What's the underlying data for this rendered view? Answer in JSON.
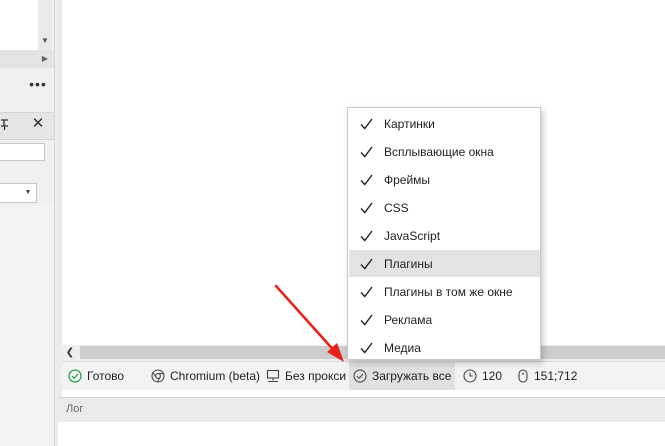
{
  "menu": {
    "items": [
      {
        "label": "Картинки",
        "checked": true
      },
      {
        "label": "Всплывающие окна",
        "checked": true
      },
      {
        "label": "Фреймы",
        "checked": true
      },
      {
        "label": "CSS",
        "checked": true
      },
      {
        "label": "JavaScript",
        "checked": true
      },
      {
        "label": "Плагины",
        "checked": true,
        "highlighted": true
      },
      {
        "label": "Плагины в том же окне",
        "checked": true
      },
      {
        "label": "Реклама",
        "checked": true
      },
      {
        "label": "Медиа",
        "checked": true
      }
    ]
  },
  "statusbar": {
    "status": "Готово",
    "browser": "Chromium (beta)",
    "proxy": "Без прокси",
    "load": "Загружать все",
    "timeout": "120",
    "coords": "151;712"
  },
  "log": {
    "title": "Лог"
  },
  "left": {
    "more": "•••",
    "close": "✕"
  },
  "colors": {
    "status_ok": "#2e9e4c",
    "arrow": "#e8231b",
    "highlight": "#e3e3e3"
  }
}
